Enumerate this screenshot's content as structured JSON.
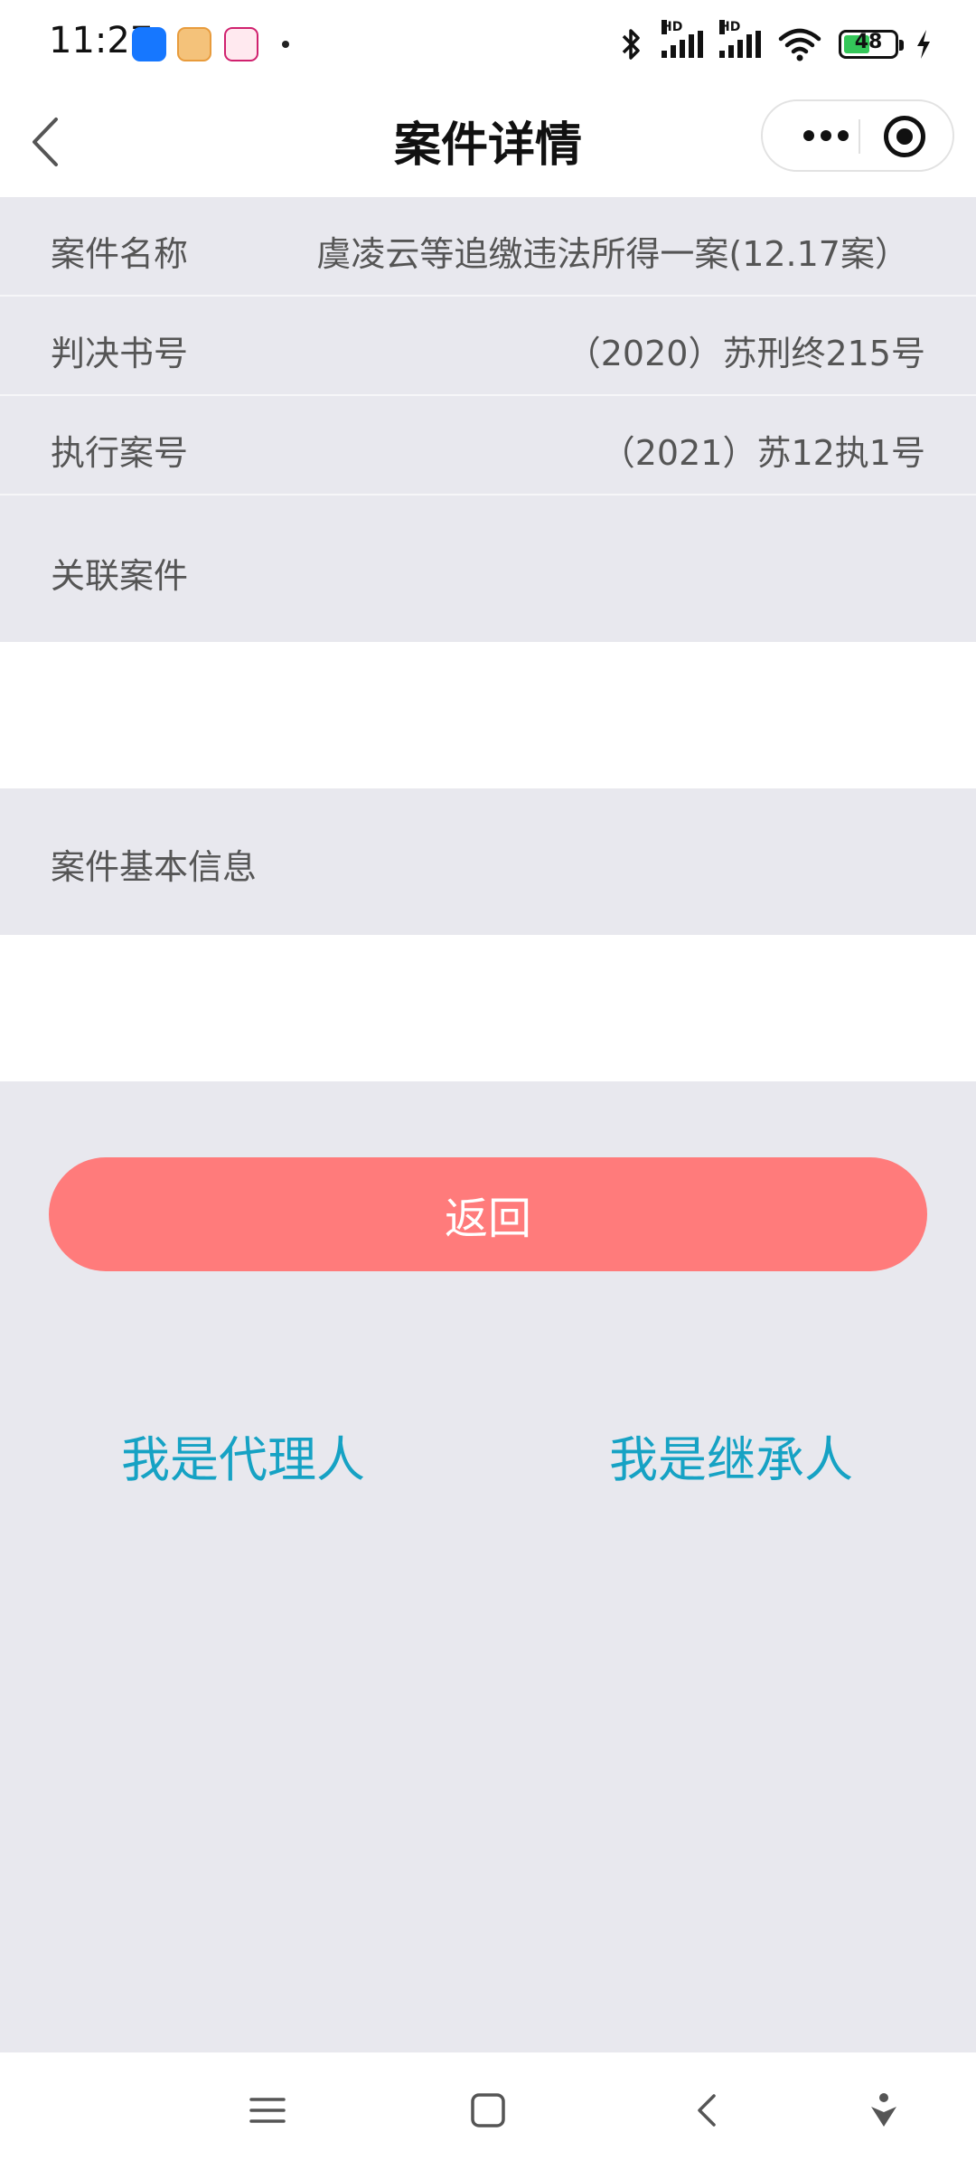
{
  "status_bar": {
    "time": "11:27",
    "battery_level": "48",
    "signal_labels": [
      "HD",
      "HD"
    ]
  },
  "nav": {
    "title": "案件详情"
  },
  "details": {
    "case_name_label": "案件名称",
    "case_name_value": "虞凌云等追缴违法所得一案(12.17案）",
    "verdict_no_label": "判决书号",
    "verdict_no_value": "（2020）苏刑终215号",
    "execution_no_label": "执行案号",
    "execution_no_value": "（2021）苏12执1号",
    "related_cases_label": "关联案件",
    "basic_info_label": "案件基本信息"
  },
  "actions": {
    "return_label": "返回",
    "agent_label": "我是代理人",
    "heir_label": "我是继承人"
  },
  "colors": {
    "return_button": "#ff7b7b",
    "link": "#16a2c4",
    "row_background": "#e8e8ee"
  }
}
